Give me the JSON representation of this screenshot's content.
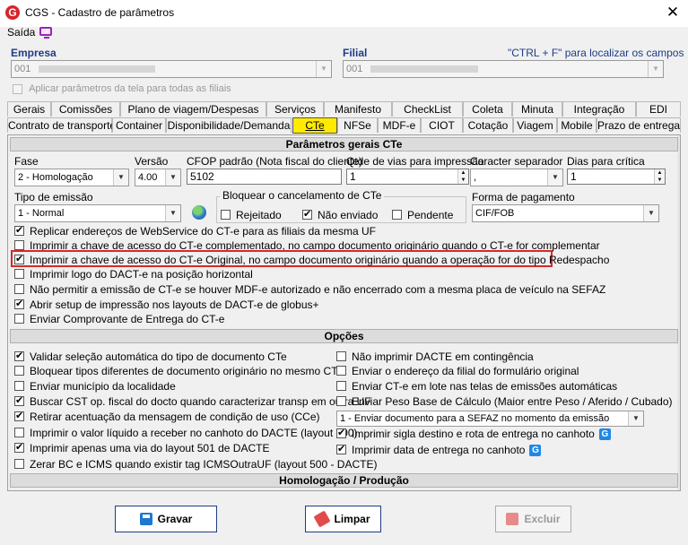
{
  "window": {
    "title": "CGS - Cadastro de parâmetros",
    "logo_letter": "G",
    "close": "✕"
  },
  "menu": {
    "saida": "Saída"
  },
  "empresa": {
    "label": "Empresa",
    "value": "001",
    "apply_all": "Aplicar parâmetros da tela para todas as filiais"
  },
  "filial": {
    "label": "Filial",
    "value": "001",
    "hint": "\"CTRL + F\" para localizar os campos"
  },
  "tabs_row1": [
    "Gerais",
    "Comissões",
    "Plano de viagem/Despesas",
    "Serviços",
    "Manifesto",
    "CheckList",
    "Coleta",
    "Minuta",
    "Integração",
    "EDI"
  ],
  "tabs_row2": [
    "Contrato de transporte",
    "Container",
    "Disponibilidade/Demanda",
    "CTe",
    "NFSe",
    "MDF-e",
    "CIOT",
    "Cotação",
    "Viagem",
    "Mobile",
    "Prazo de entrega"
  ],
  "sections": {
    "params": "Parâmetros gerais CTe",
    "opcoes": "Opções",
    "homolog": "Homologação / Produção"
  },
  "fields": {
    "fase": {
      "label": "Fase",
      "value": "2 - Homologação"
    },
    "versao": {
      "label": "Versão",
      "value": "4.00"
    },
    "cfop": {
      "label": "CFOP padrão (Nota fiscal do cliente)",
      "value": "5102"
    },
    "vias": {
      "label": "Qtde de vias para impressão",
      "value": "1"
    },
    "separador": {
      "label": "Caracter separador",
      "value": ","
    },
    "dias": {
      "label": "Dias para crítica",
      "value": "1"
    },
    "emissao": {
      "label": "Tipo de emissão",
      "value": "1 - Normal"
    },
    "bloquear": {
      "label": "Bloquear o cancelamento de CTe",
      "rejeitado": "Rejeitado",
      "nao_enviado": "Não enviado",
      "pendente": "Pendente"
    },
    "pagamento": {
      "label": "Forma de pagamento",
      "value": "CIF/FOB"
    }
  },
  "params_checks": [
    {
      "label": "Replicar endereços de WebService do CT-e para as filiais da mesma UF",
      "checked": true
    },
    {
      "label": "Imprimir a chave de acesso do CT-e complementado, no campo documento originário quando o CT-e for complementar",
      "checked": false
    },
    {
      "label": "Imprimir a chave de acesso do CT-e Original, no campo documento originário quando a operação for do tipo Redespacho",
      "checked": true
    },
    {
      "label": "Imprimir logo do DACT-e na posição horizontal",
      "checked": false
    },
    {
      "label": "Não permitir a emissão de CT-e se houver MDF-e autorizado e não encerrado com a mesma placa de veículo na SEFAZ",
      "checked": false
    },
    {
      "label": "Abrir setup de impressão nos layouts de DACT-e de globus+",
      "checked": true
    },
    {
      "label": "Enviar Comprovante de Entrega do CT-e",
      "checked": false
    }
  ],
  "options_left": [
    {
      "label": "Validar seleção automática do tipo de documento CTe",
      "checked": true
    },
    {
      "label": "Bloquear tipos diferentes de documento originário no mesmo CTe",
      "checked": false
    },
    {
      "label": "Enviar município da localidade",
      "checked": false
    },
    {
      "label": "Buscar CST op. fiscal do docto quando caracterizar transp em outra UF",
      "checked": true
    },
    {
      "label": "Retirar acentuação da mensagem de condição de uso (CCe)",
      "checked": true
    },
    {
      "label": "Imprimir o valor líquido a receber no canhoto do DACTE (layout 500)",
      "checked": false
    },
    {
      "label": "Imprimir apenas uma via do layout 501 de DACTE",
      "checked": true
    },
    {
      "label": "Zerar BC e ICMS quando existir tag ICMSOutraUF (layout 500 - DACTE)",
      "checked": false
    }
  ],
  "options_right": [
    {
      "label": "Não imprimir DACTE em contingência",
      "checked": false
    },
    {
      "label": "Enviar o endereço da filial do formulário original",
      "checked": false
    },
    {
      "label": "Enviar CT-e em lote nas telas de emissões automáticas",
      "checked": false
    },
    {
      "label": "Enviar Peso Base de Cálculo (Maior entre Peso / Aferido / Cubado)",
      "checked": false
    }
  ],
  "envio_combo": "1 - Enviar documento para a SEFAZ no momento da emissão",
  "options_right2": [
    {
      "label": "Imprimir sigla destino e rota de entrega no canhoto",
      "checked": true,
      "icon": "G"
    },
    {
      "label": "Imprimir data de entrega no canhoto",
      "checked": true,
      "icon": "G"
    }
  ],
  "buttons": {
    "gravar": "Gravar",
    "limpar": "Limpar",
    "excluir": "Excluir"
  },
  "colors": {
    "accent": "#1f3c88",
    "highlight": "#d42a2a",
    "active_tab": "#ffea00"
  }
}
